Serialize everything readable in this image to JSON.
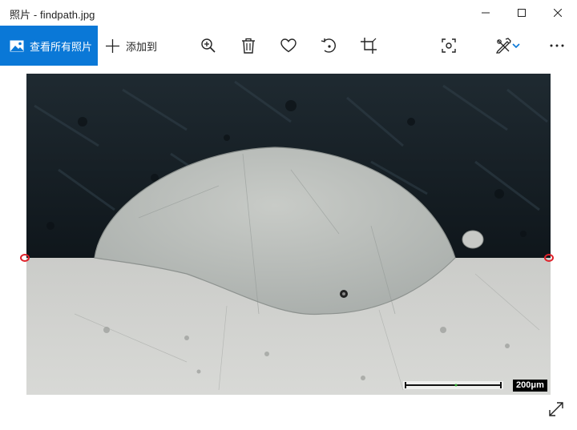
{
  "window": {
    "title": "照片 - findpath.jpg"
  },
  "toolbar": {
    "see_all_label": "查看所有照片",
    "add_to_label": "添加到"
  },
  "image": {
    "scale_label": "200μm"
  },
  "colors": {
    "accent": "#0a78d7",
    "marker": "#e0212a"
  },
  "icons": [
    "image-icon",
    "plus-icon",
    "zoom-in-icon",
    "delete-icon",
    "heart-icon",
    "rotate-icon",
    "crop-icon",
    "focus-icon",
    "edit-icon",
    "chevron-down-icon",
    "more-icon",
    "expand-icon",
    "minimize-icon",
    "maximize-icon",
    "close-icon"
  ]
}
